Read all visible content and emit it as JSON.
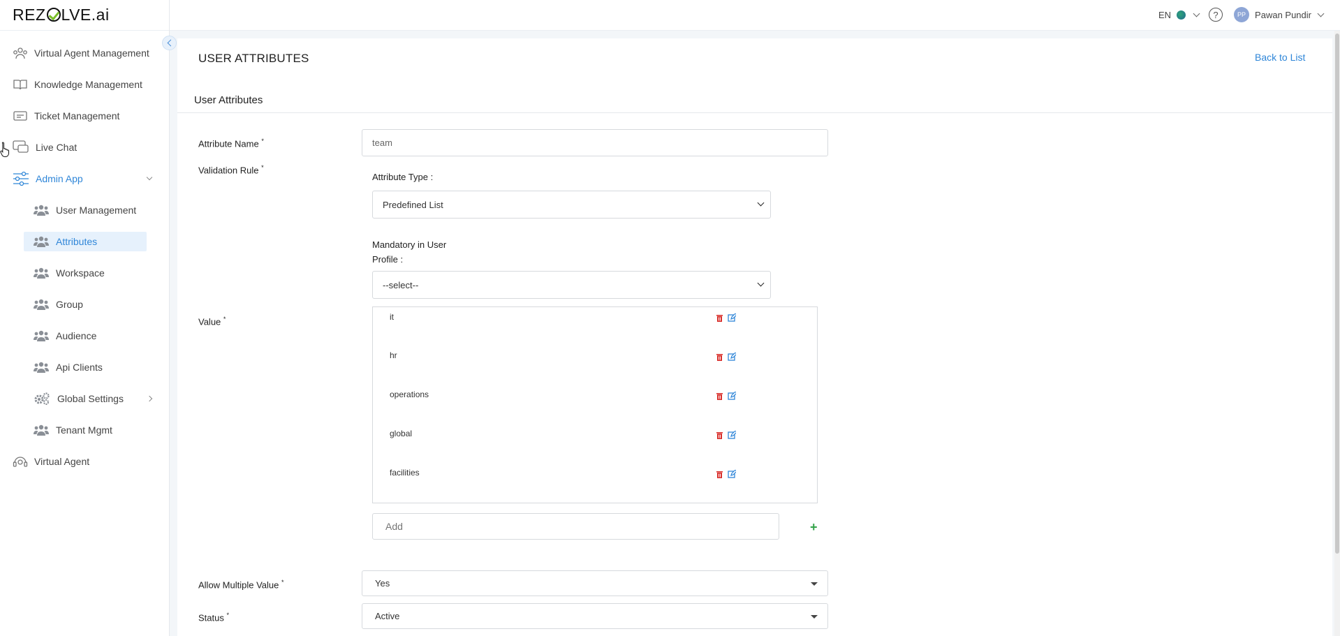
{
  "header": {
    "logo": "REZOLVE.ai",
    "language": "EN",
    "user_initials": "PP",
    "user_name": "Pawan Pundir"
  },
  "sidebar": {
    "items": [
      {
        "label": "Virtual Agent Management",
        "icon": "users-icon"
      },
      {
        "label": "Knowledge Management",
        "icon": "book-icon"
      },
      {
        "label": "Ticket Management",
        "icon": "ticket-icon"
      },
      {
        "label": "Live Chat",
        "icon": "chat-icon"
      },
      {
        "label": "Admin App",
        "icon": "sliders-icon"
      },
      {
        "label": "Virtual Agent",
        "icon": "agent-icon"
      }
    ],
    "admin_sub_items": [
      {
        "label": "User Management"
      },
      {
        "label": "Attributes"
      },
      {
        "label": "Workspace"
      },
      {
        "label": "Group"
      },
      {
        "label": "Audience"
      },
      {
        "label": "Api Clients"
      },
      {
        "label": "Global Settings"
      },
      {
        "label": "Tenant Mgmt"
      }
    ],
    "active_sub_item": "Attributes"
  },
  "page": {
    "title": "USER ATTRIBUTES",
    "back_link": "Back to List",
    "section_title": "User Attributes"
  },
  "form": {
    "attribute_name_label": "Attribute Name",
    "attribute_name_value": "team",
    "validation_rule_label": "Validation Rule",
    "attribute_type_label": "Attribute Type :",
    "attribute_type_value": "Predefined List",
    "mandatory_label_line1": "Mandatory in User",
    "mandatory_label_line2": "Profile :",
    "mandatory_value": "--select--",
    "value_label": "Value",
    "values": [
      "it",
      "hr",
      "operations",
      "global",
      "facilities"
    ],
    "add_placeholder": "Add",
    "allow_multiple_label": "Allow Multiple Value",
    "allow_multiple_value": "Yes",
    "status_label": "Status",
    "status_value": "Active",
    "required_mark": "*"
  },
  "colors": {
    "accent": "#2f86d8",
    "delete": "#d9302c",
    "add": "#34a34a"
  }
}
